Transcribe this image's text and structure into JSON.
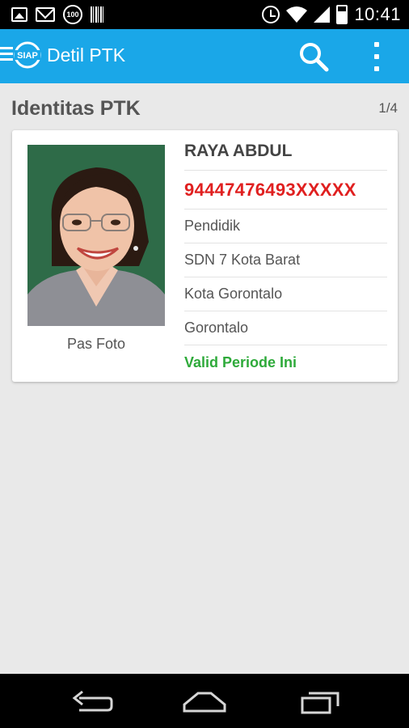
{
  "status_bar": {
    "time": "10:41",
    "badge_100": "100",
    "left_icons": [
      "image-icon",
      "mail-icon",
      "battery-100-icon",
      "barcode-icon"
    ],
    "right_icons": [
      "alarm-icon",
      "wifi-icon",
      "signal-icon",
      "battery-icon"
    ]
  },
  "app_bar": {
    "title": "Detil PTK",
    "logo_text": "SIAP",
    "color": "#1aa7e8"
  },
  "section": {
    "title": "Identitas PTK",
    "pager": "1/4"
  },
  "card": {
    "photo_caption": "Pas Foto",
    "name": "RAYA ABDUL",
    "nuptk": "94447476493XXXXX",
    "role": "Pendidik",
    "school": "SDN 7 Kota Barat",
    "city": "Kota Gorontalo",
    "province": "Gorontalo",
    "status": "Valid Periode Ini",
    "colors": {
      "nuptk": "#e02020",
      "status": "#2eaa3a"
    }
  },
  "nav_bar": {
    "icons": [
      "back-icon",
      "home-icon",
      "recents-icon"
    ]
  }
}
